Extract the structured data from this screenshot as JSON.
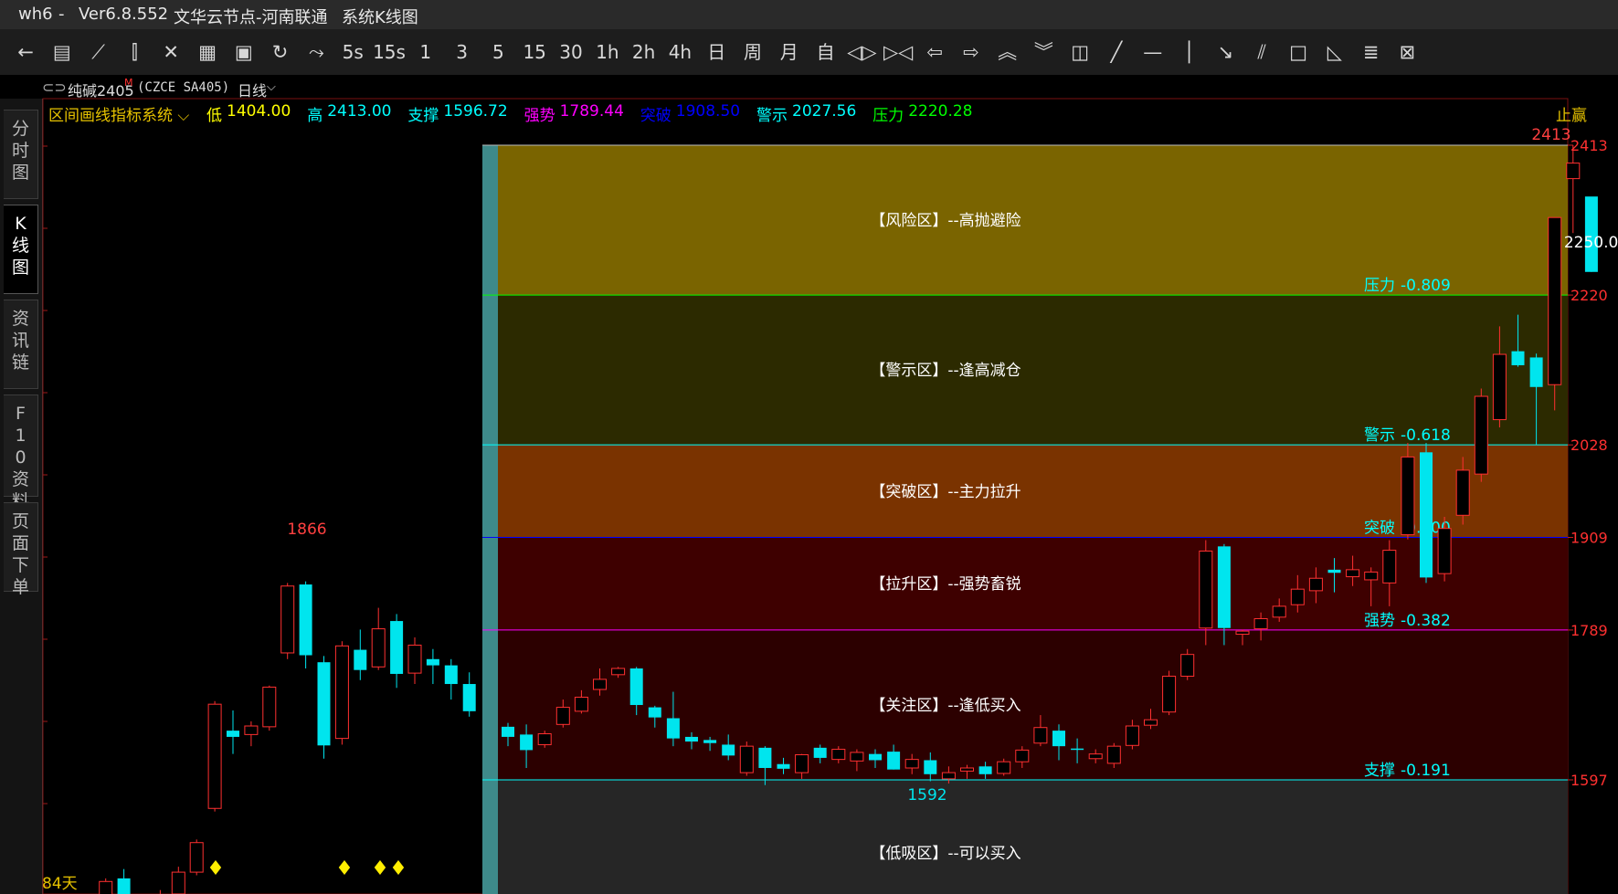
{
  "titlebar": {
    "app": "wh6",
    "sep": "-",
    "version": "Ver6.8.552",
    "server": "文华云节点-河南联通",
    "window": "系统K线图"
  },
  "toolbar": {
    "icons": [
      "back-arrow-icon",
      "table-icon",
      "line-icon",
      "candlestick-icon",
      "cross-icon",
      "doc-icon",
      "save-icon",
      "refresh-icon",
      "compare-icon"
    ],
    "periods": [
      "5s",
      "15s",
      "1",
      "3",
      "5",
      "15",
      "30",
      "1h",
      "2h",
      "4h",
      "日",
      "周",
      "月",
      "自"
    ],
    "tools": [
      "zoom-out-icon",
      "zoom-in-icon",
      "left-arrow-icon",
      "right-arrow-icon",
      "up-double-icon",
      "down-double-icon",
      "layout-icon",
      "trendline-icon",
      "hline-icon",
      "vline-icon",
      "ray-icon",
      "parallel-icon",
      "rect-icon",
      "triangle-icon",
      "text-icon",
      "clear-icon"
    ]
  },
  "instrument": {
    "name": "纯碱2405",
    "badge": "M",
    "code": "(CZCE SA405)",
    "period": "日线"
  },
  "sidebar": {
    "tabs": [
      "分时图",
      "K线图",
      "资讯链",
      "F10资料",
      "页面下单"
    ],
    "active": 1
  },
  "indicator": {
    "name": "区间画线指标系统",
    "items": [
      {
        "label": "低",
        "value": "1404.00",
        "color": "#ffff00"
      },
      {
        "label": "高",
        "value": "2413.00",
        "color": "#00ffff"
      },
      {
        "label": "支撑",
        "value": "1596.72",
        "color": "#00ffff"
      },
      {
        "label": "强势",
        "value": "1789.44",
        "color": "#ff00ff"
      },
      {
        "label": "突破",
        "value": "1908.50",
        "color": "#0000ff"
      },
      {
        "label": "警示",
        "value": "2027.56",
        "color": "#00ffff"
      },
      {
        "label": "压力",
        "value": "2220.28",
        "color": "#00ff00"
      }
    ],
    "corner_label": "止赢"
  },
  "chart_data": {
    "type": "candlestick",
    "ylim": [
      1404,
      2480
    ],
    "bars": [
      {
        "o": 1407,
        "h": 1425,
        "l": 1404,
        "c": 1412
      },
      {
        "o": 1412,
        "h": 1445,
        "l": 1408,
        "c": 1440
      },
      {
        "o": 1440,
        "h": 1445,
        "l": 1420,
        "c": 1428
      },
      {
        "o": 1430,
        "h": 1470,
        "l": 1426,
        "c": 1466
      },
      {
        "o": 1470,
        "h": 1482,
        "l": 1418,
        "c": 1435
      },
      {
        "o": 1436,
        "h": 1440,
        "l": 1418,
        "c": 1436
      },
      {
        "o": 1438,
        "h": 1455,
        "l": 1432,
        "c": 1446
      },
      {
        "o": 1450,
        "h": 1485,
        "l": 1448,
        "c": 1478
      },
      {
        "o": 1478,
        "h": 1520,
        "l": 1474,
        "c": 1516
      },
      {
        "o": 1560,
        "h": 1698,
        "l": 1556,
        "c": 1694
      },
      {
        "o": 1660,
        "h": 1686,
        "l": 1630,
        "c": 1652
      },
      {
        "o": 1655,
        "h": 1672,
        "l": 1640,
        "c": 1666
      },
      {
        "o": 1665,
        "h": 1718,
        "l": 1660,
        "c": 1716
      },
      {
        "o": 1760,
        "h": 1850,
        "l": 1752,
        "c": 1846
      },
      {
        "o": 1848,
        "h": 1852,
        "l": 1740,
        "c": 1757
      },
      {
        "o": 1748,
        "h": 1756,
        "l": 1624,
        "c": 1641
      },
      {
        "o": 1650,
        "h": 1775,
        "l": 1642,
        "c": 1769
      },
      {
        "o": 1764,
        "h": 1790,
        "l": 1725,
        "c": 1738
      },
      {
        "o": 1742,
        "h": 1818,
        "l": 1738,
        "c": 1791
      },
      {
        "o": 1801,
        "h": 1810,
        "l": 1715,
        "c": 1733
      },
      {
        "o": 1734,
        "h": 1780,
        "l": 1720,
        "c": 1770
      },
      {
        "o": 1752,
        "h": 1765,
        "l": 1720,
        "c": 1744
      },
      {
        "o": 1744,
        "h": 1752,
        "l": 1700,
        "c": 1720
      },
      {
        "o": 1720,
        "h": 1735,
        "l": 1678,
        "c": 1685
      }
    ],
    "bars2": [
      {
        "o": 1665,
        "h": 1670,
        "l": 1640,
        "c": 1652
      },
      {
        "o": 1655,
        "h": 1668,
        "l": 1612,
        "c": 1635
      },
      {
        "o": 1642,
        "h": 1660,
        "l": 1638,
        "c": 1656
      },
      {
        "o": 1668,
        "h": 1700,
        "l": 1664,
        "c": 1690
      },
      {
        "o": 1685,
        "h": 1712,
        "l": 1682,
        "c": 1703
      },
      {
        "o": 1713,
        "h": 1740,
        "l": 1705,
        "c": 1726
      },
      {
        "o": 1732,
        "h": 1742,
        "l": 1728,
        "c": 1740
      },
      {
        "o": 1740,
        "h": 1742,
        "l": 1680,
        "c": 1693
      },
      {
        "o": 1690,
        "h": 1692,
        "l": 1664,
        "c": 1677
      },
      {
        "o": 1676,
        "h": 1710,
        "l": 1640,
        "c": 1650
      },
      {
        "o": 1652,
        "h": 1658,
        "l": 1636,
        "c": 1646
      },
      {
        "o": 1648,
        "h": 1652,
        "l": 1634,
        "c": 1644
      },
      {
        "o": 1642,
        "h": 1655,
        "l": 1622,
        "c": 1628
      },
      {
        "o": 1606,
        "h": 1646,
        "l": 1602,
        "c": 1640
      },
      {
        "o": 1638,
        "h": 1640,
        "l": 1590,
        "c": 1612
      },
      {
        "o": 1617,
        "h": 1625,
        "l": 1604,
        "c": 1611
      },
      {
        "o": 1606,
        "h": 1630,
        "l": 1598,
        "c": 1629
      },
      {
        "o": 1638,
        "h": 1642,
        "l": 1618,
        "c": 1625
      },
      {
        "o": 1623,
        "h": 1640,
        "l": 1618,
        "c": 1636
      },
      {
        "o": 1621,
        "h": 1636,
        "l": 1608,
        "c": 1632
      },
      {
        "o": 1630,
        "h": 1636,
        "l": 1612,
        "c": 1622
      },
      {
        "o": 1633,
        "h": 1642,
        "l": 1610,
        "c": 1610
      },
      {
        "o": 1612,
        "h": 1630,
        "l": 1604,
        "c": 1623
      },
      {
        "o": 1622,
        "h": 1632,
        "l": 1595,
        "c": 1604
      },
      {
        "o": 1598,
        "h": 1614,
        "l": 1592,
        "c": 1606
      },
      {
        "o": 1608,
        "h": 1616,
        "l": 1598,
        "c": 1612
      },
      {
        "o": 1614,
        "h": 1620,
        "l": 1598,
        "c": 1604
      },
      {
        "o": 1605,
        "h": 1624,
        "l": 1602,
        "c": 1620
      },
      {
        "o": 1620,
        "h": 1640,
        "l": 1612,
        "c": 1635
      },
      {
        "o": 1644,
        "h": 1680,
        "l": 1640,
        "c": 1664
      },
      {
        "o": 1660,
        "h": 1668,
        "l": 1622,
        "c": 1640
      },
      {
        "o": 1637,
        "h": 1650,
        "l": 1618,
        "c": 1636
      },
      {
        "o": 1624,
        "h": 1636,
        "l": 1618,
        "c": 1630
      },
      {
        "o": 1618,
        "h": 1644,
        "l": 1612,
        "c": 1640
      },
      {
        "o": 1641,
        "h": 1674,
        "l": 1636,
        "c": 1666
      },
      {
        "o": 1667,
        "h": 1688,
        "l": 1662,
        "c": 1674
      },
      {
        "o": 1684,
        "h": 1737,
        "l": 1680,
        "c": 1730
      },
      {
        "o": 1730,
        "h": 1765,
        "l": 1725,
        "c": 1758
      },
      {
        "o": 1792,
        "h": 1905,
        "l": 1770,
        "c": 1891
      },
      {
        "o": 1897,
        "h": 1900,
        "l": 1770,
        "c": 1792
      },
      {
        "o": 1784,
        "h": 1790,
        "l": 1770,
        "c": 1788
      },
      {
        "o": 1791,
        "h": 1812,
        "l": 1776,
        "c": 1804
      },
      {
        "o": 1806,
        "h": 1830,
        "l": 1800,
        "c": 1820
      },
      {
        "o": 1822,
        "h": 1860,
        "l": 1812,
        "c": 1842
      },
      {
        "o": 1840,
        "h": 1870,
        "l": 1824,
        "c": 1856
      },
      {
        "o": 1867,
        "h": 1882,
        "l": 1838,
        "c": 1863
      },
      {
        "o": 1858,
        "h": 1885,
        "l": 1846,
        "c": 1867
      },
      {
        "o": 1854,
        "h": 1870,
        "l": 1820,
        "c": 1864
      },
      {
        "o": 1850,
        "h": 1905,
        "l": 1820,
        "c": 1892
      },
      {
        "o": 1912,
        "h": 2030,
        "l": 1906,
        "c": 2012
      },
      {
        "o": 2018,
        "h": 2030,
        "l": 1850,
        "c": 1857
      },
      {
        "o": 1862,
        "h": 1935,
        "l": 1852,
        "c": 1920
      },
      {
        "o": 1937,
        "h": 2012,
        "l": 1925,
        "c": 1995
      },
      {
        "o": 1990,
        "h": 2100,
        "l": 1980,
        "c": 2090
      },
      {
        "o": 2060,
        "h": 2180,
        "l": 2050,
        "c": 2144
      },
      {
        "o": 2148,
        "h": 2195,
        "l": 2128,
        "c": 2130
      },
      {
        "o": 2140,
        "h": 2145,
        "l": 2028,
        "c": 2102
      },
      {
        "o": 2105,
        "h": 2320,
        "l": 2072,
        "c": 2320
      },
      {
        "o": 2370,
        "h": 2413,
        "l": 2300,
        "c": 2390
      },
      {
        "o": 2347,
        "h": 2340,
        "l": 2250,
        "c": 2250
      }
    ],
    "last_price": "2250.00",
    "high_mark": "2413",
    "high_mark_left": "1866",
    "low_mark": "1592",
    "bars_count_label": "84天",
    "axis_ticks": [
      "2413",
      "2220",
      "2028",
      "1909",
      "1789",
      "1597"
    ],
    "zones": [
      {
        "label": "【风险区】--高抛避险",
        "top": 2413,
        "bottom": 2220.28,
        "color": "#7a6400"
      },
      {
        "label": "【警示区】--逢高减仓",
        "top": 2220.28,
        "bottom": 2027.56,
        "color": "#2c2a00"
      },
      {
        "label": "【突破区】--主力拉升",
        "top": 2027.56,
        "bottom": 1908.5,
        "color": "#7a3300"
      },
      {
        "label": "【拉升区】--强势畜锐",
        "top": 1908.5,
        "bottom": 1789.44,
        "color": "#3e0000"
      },
      {
        "label": "【关注区】--逢低买入",
        "top": 1789.44,
        "bottom": 1596.72,
        "color": "#2c0000"
      },
      {
        "label": "【低吸区】--可以买入",
        "top": 1596.72,
        "bottom": 1404,
        "color": "#262626"
      }
    ],
    "levels": [
      {
        "name": "压力",
        "ratio": "-0.809",
        "value": 2220.28,
        "color": "#00ff00"
      },
      {
        "name": "警示",
        "ratio": "-0.618",
        "value": 2027.56,
        "color": "#00ffff"
      },
      {
        "name": "突破",
        "ratio": "-0.500",
        "value": 1908.5,
        "color": "#0000ff"
      },
      {
        "name": "强势",
        "ratio": "-0.382",
        "value": 1789.44,
        "color": "#ff00ff"
      },
      {
        "name": "支撑",
        "ratio": "-0.191",
        "value": 1596.72,
        "color": "#00ffff"
      }
    ],
    "signal_marks": [
      "♦",
      "♦",
      "♦",
      "♦"
    ]
  }
}
